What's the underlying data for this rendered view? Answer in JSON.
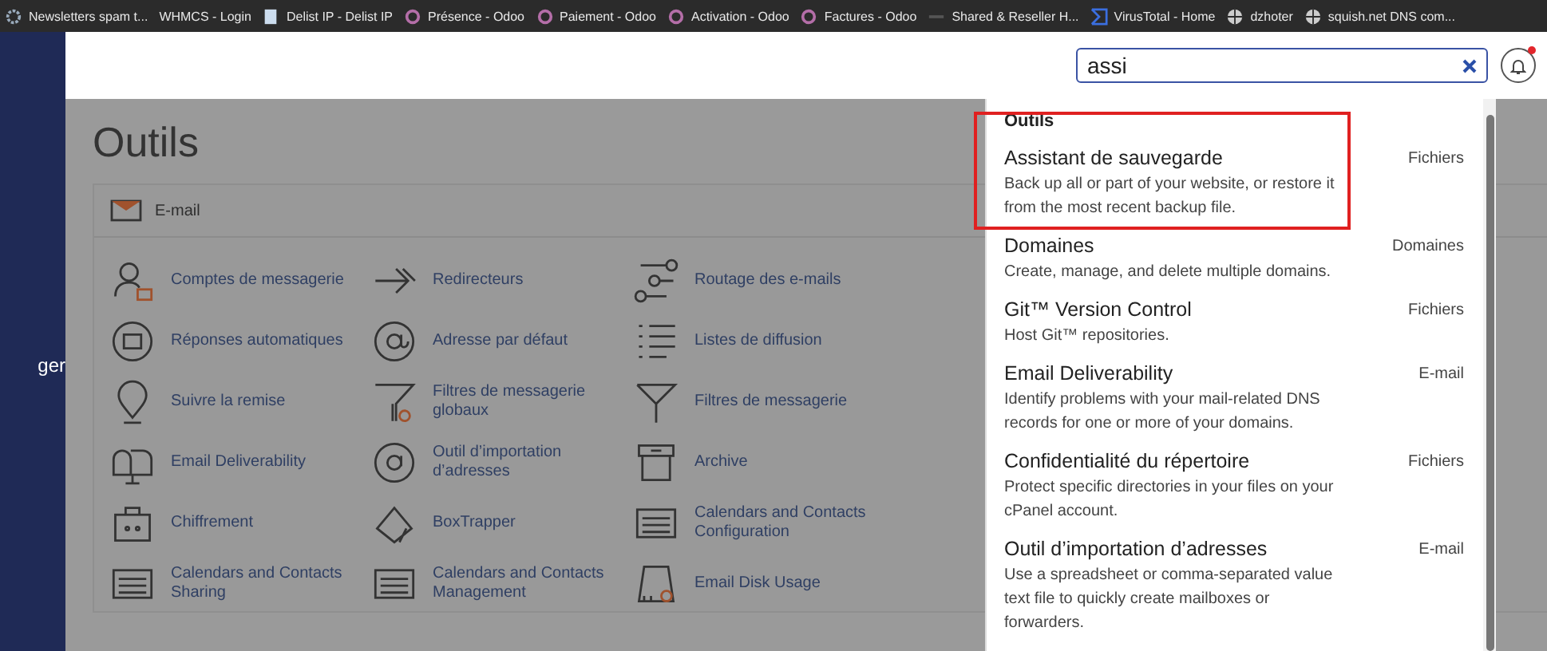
{
  "bookmarks": [
    {
      "label": "Newsletters spam t...",
      "kind": "gear"
    },
    {
      "label": "WHMCS - Login",
      "kind": "none"
    },
    {
      "label": "Delist IP - Delist IP",
      "kind": "page"
    },
    {
      "label": "Présence - Odoo",
      "kind": "ring"
    },
    {
      "label": "Paiement - Odoo",
      "kind": "ring"
    },
    {
      "label": "Activation - Odoo",
      "kind": "ring"
    },
    {
      "label": "Factures - Odoo",
      "kind": "ring"
    },
    {
      "label": "Shared & Reseller H...",
      "kind": "dash"
    },
    {
      "label": "VirusTotal - Home",
      "kind": "vt"
    },
    {
      "label": "dzhoter",
      "kind": "globe"
    },
    {
      "label": "squish.net DNS com...",
      "kind": "globe"
    }
  ],
  "sidebar": {
    "label": "ger"
  },
  "search": {
    "value": "assi"
  },
  "notifications": {
    "unread": true
  },
  "page": {
    "title": "Outils"
  },
  "section": {
    "title": "E-mail",
    "tools": [
      {
        "label": "Comptes de messagerie"
      },
      {
        "label": "Redirecteurs"
      },
      {
        "label": "Routage des e-mails"
      },
      {
        "label": "Réponses automatiques"
      },
      {
        "label": "Adresse par défaut"
      },
      {
        "label": "Listes de diffusion"
      },
      {
        "label": "Suivre la remise"
      },
      {
        "label": "Filtres de messagerie globaux"
      },
      {
        "label": "Filtres de messagerie"
      },
      {
        "label": "Email Deliverability"
      },
      {
        "label": "Outil d’importation d’adresses"
      },
      {
        "label": "Archive"
      },
      {
        "label": "Chiffrement"
      },
      {
        "label": "BoxTrapper"
      },
      {
        "label": "Calendars and Contacts Configuration"
      },
      {
        "label": "Calendars and Contacts Sharing"
      },
      {
        "label": "Calendars and Contacts Management"
      },
      {
        "label": "Email Disk Usage"
      }
    ]
  },
  "results": {
    "heading": "Outils",
    "items": [
      {
        "title": "Assistant de sauvegarde",
        "description": "Back up all or part of your website, or restore it from the most recent backup file.",
        "category": "Fichiers",
        "highlighted": true
      },
      {
        "title": "Domaines",
        "description": "Create, manage, and delete multiple domains.",
        "category": "Domaines",
        "highlighted": false
      },
      {
        "title": "Git™ Version Control",
        "description": "Host Git™ repositories.",
        "category": "Fichiers",
        "highlighted": false
      },
      {
        "title": "Email Deliverability",
        "description": "Identify problems with your mail-related DNS records for one or more of your domains.",
        "category": "E-mail",
        "highlighted": false
      },
      {
        "title": "Confidentialité du répertoire",
        "description": "Protect specific directories in your files on your cPanel account.",
        "category": "Fichiers",
        "highlighted": false
      },
      {
        "title": "Outil d’importation d’adresses",
        "description": "Use a spreadsheet or comma-separated value text file to quickly create mailboxes or forwarders.",
        "category": "E-mail",
        "highlighted": false
      }
    ]
  }
}
